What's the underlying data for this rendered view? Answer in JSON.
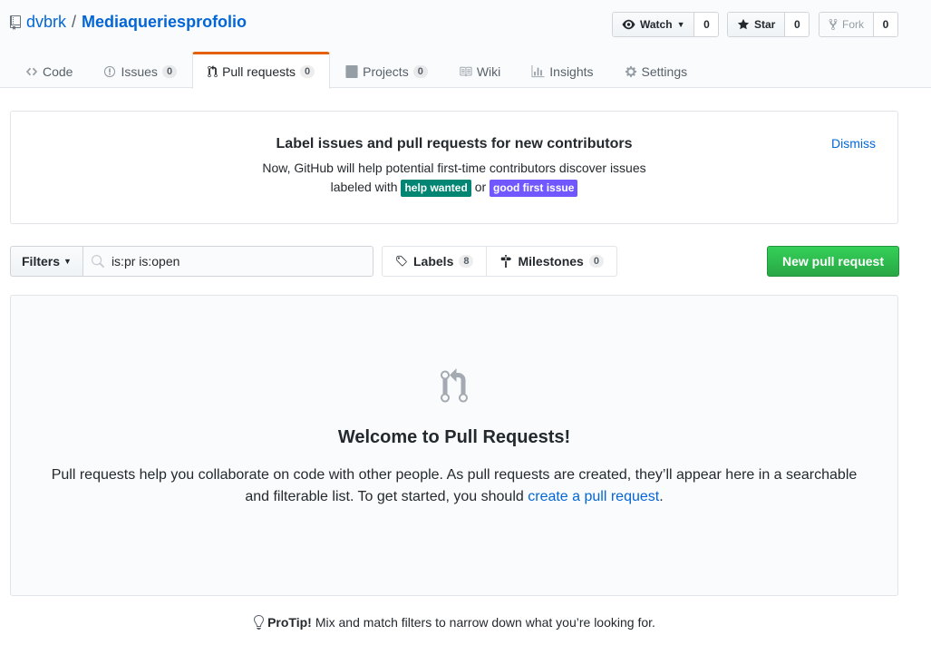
{
  "repo": {
    "owner": "dvbrk",
    "separator": "/",
    "name": "Mediaqueriesprofolio"
  },
  "actions": {
    "watch": {
      "label": "Watch",
      "count": "0"
    },
    "star": {
      "label": "Star",
      "count": "0"
    },
    "fork": {
      "label": "Fork",
      "count": "0"
    }
  },
  "nav": {
    "code": {
      "label": "Code"
    },
    "issues": {
      "label": "Issues",
      "count": "0"
    },
    "pulls": {
      "label": "Pull requests",
      "count": "0"
    },
    "projects": {
      "label": "Projects",
      "count": "0"
    },
    "wiki": {
      "label": "Wiki"
    },
    "insights": {
      "label": "Insights"
    },
    "settings": {
      "label": "Settings"
    }
  },
  "banner": {
    "title": "Label issues and pull requests for new contributors",
    "line1": "Now, GitHub will help potential first-time contributors discover issues",
    "line2_pre": "labeled with",
    "label1": "help wanted",
    "label1_color": "#008672",
    "or": "or",
    "label2": "good first issue",
    "label2_color": "#7057ff",
    "dismiss": "Dismiss"
  },
  "subnav": {
    "filters_label": "Filters",
    "search_value": "is:pr is:open",
    "labels": {
      "label": "Labels",
      "count": "8"
    },
    "milestones": {
      "label": "Milestones",
      "count": "0"
    },
    "new_pr": "New pull request"
  },
  "blankslate": {
    "title": "Welcome to Pull Requests!",
    "text": "Pull requests help you collaborate on code with other people. As pull requests are created, they’ll appear here in a searchable and filterable list. To get started, you should",
    "link": "create a pull request",
    "end": "."
  },
  "protip": {
    "bold": "ProTip!",
    "text": "Mix and match filters to narrow down what you’re looking for."
  },
  "colors": {
    "accent": "#0366d6",
    "tab_selected": "#e36209",
    "primary_btn": "#28a745"
  }
}
